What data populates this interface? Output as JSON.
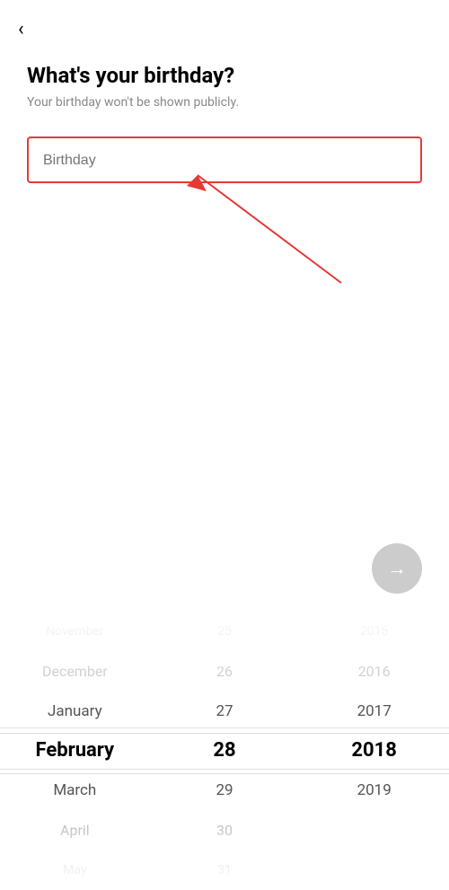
{
  "back": {
    "icon": "‹"
  },
  "header": {
    "title": "What's your birthday?",
    "subtitle": "Your birthday won't be shown publicly."
  },
  "birthday_input": {
    "placeholder": "Birthday",
    "value": ""
  },
  "next_button": {
    "label": "→"
  },
  "date_picker": {
    "columns": {
      "month": {
        "items": [
          {
            "label": "November",
            "state": "far"
          },
          {
            "label": "December",
            "state": "mid"
          },
          {
            "label": "January",
            "state": "near"
          },
          {
            "label": "February",
            "state": "selected"
          },
          {
            "label": "March",
            "state": "near"
          },
          {
            "label": "April",
            "state": "mid"
          },
          {
            "label": "May",
            "state": "far"
          }
        ]
      },
      "day": {
        "items": [
          {
            "label": "25",
            "state": "far"
          },
          {
            "label": "26",
            "state": "mid"
          },
          {
            "label": "27",
            "state": "near"
          },
          {
            "label": "28",
            "state": "selected"
          },
          {
            "label": "29",
            "state": "near"
          },
          {
            "label": "30",
            "state": "mid"
          },
          {
            "label": "31",
            "state": "far"
          }
        ]
      },
      "year": {
        "items": [
          {
            "label": "2015",
            "state": "far"
          },
          {
            "label": "2016",
            "state": "mid"
          },
          {
            "label": "2017",
            "state": "near"
          },
          {
            "label": "2018",
            "state": "selected"
          },
          {
            "label": "2019",
            "state": "near"
          },
          {
            "label": "",
            "state": "mid"
          },
          {
            "label": "",
            "state": "far"
          }
        ]
      }
    }
  }
}
